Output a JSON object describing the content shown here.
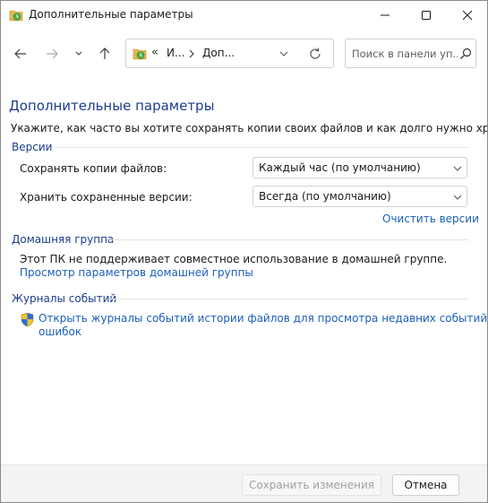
{
  "window": {
    "title": "Дополнительные параметры",
    "icon": "file-history-icon"
  },
  "nav": {
    "address_separator": "«",
    "breadcrumbs": [
      "И...",
      "Доп..."
    ],
    "search_placeholder": "Поиск в панели уп..."
  },
  "page": {
    "heading": "Дополнительные параметры",
    "description": "Укажите, как часто вы хотите сохранять копии своих файлов и как долго нужно хранить их."
  },
  "versions": {
    "title": "Версии",
    "save_copies_label": "Сохранять копии файлов:",
    "save_copies_value": "Каждый час (по умолчанию)",
    "keep_versions_label": "Хранить сохраненные версии:",
    "keep_versions_value": "Всегда (по умолчанию)",
    "clean_link": "Очистить версии"
  },
  "homegroup": {
    "title": "Домашняя группа",
    "text": "Этот ПК не поддерживает совместное использование в домашней группе.",
    "link": "Просмотр параметров домашней группы"
  },
  "eventlogs": {
    "title": "Журналы событий",
    "link_line1": "Открыть журналы событий истории файлов для просмотра недавних событий или",
    "link_line2": "ошибок"
  },
  "footer": {
    "save_label": "Сохранить изменения",
    "cancel_label": "Отмена"
  },
  "colors": {
    "heading": "#1c3d8e",
    "link": "#1b5fb8",
    "footer_bg": "#f3f3f3"
  }
}
